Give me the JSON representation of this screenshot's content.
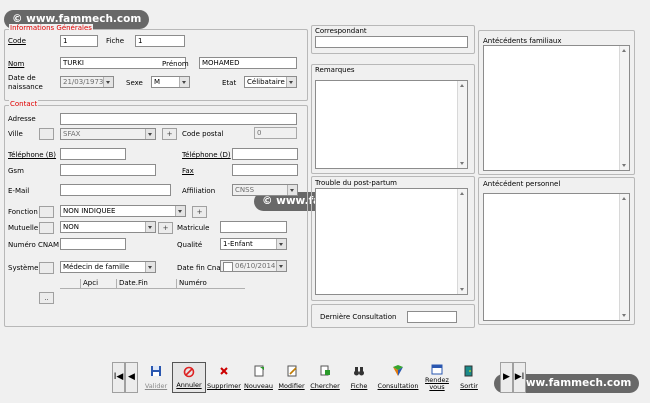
{
  "watermark": "© www.fammech.com",
  "info_generales": {
    "legend": "Informations Générales",
    "code_label": "Code",
    "code_value": "1",
    "fiche_label": "Fiche",
    "fiche_value": "1",
    "nom_label": "Nom",
    "nom_value": "TURKI",
    "prenom_label": "Prénom",
    "prenom_value": "MOHAMED",
    "date_naissance_label_1": "Date de",
    "date_naissance_label_2": "naissance",
    "date_naissance_value": "21/03/1973",
    "sexe_label": "Sexe",
    "sexe_value": "M",
    "etat_label": "Etat",
    "etat_value": "Célibataire"
  },
  "contact": {
    "legend": "Contact",
    "adresse_label": "Adresse",
    "adresse_value": "",
    "ville_label": "Ville",
    "ville_value": "SFAX",
    "code_postal_label": "Code postal",
    "code_postal_value": "0",
    "tel_b_label": "Téléphone (B)",
    "tel_b_value": "",
    "tel_d_label": "Téléphone (D)",
    "tel_d_value": "",
    "gsm_label": "Gsm",
    "gsm_value": "",
    "fax_label": "Fax",
    "fax_value": "",
    "email_label": "E-Mail",
    "email_value": "",
    "affiliation_label": "Affiliation",
    "affiliation_value": "CNSS",
    "fonction_label": "Fonction",
    "fonction_value": "NON INDIQUEE",
    "mutuelle_label": "Mutuelle",
    "mutuelle_value": "NON",
    "matricule_label": "Matricule",
    "matricule_value": "",
    "numero_cnam_label": "Numéro CNAM",
    "numero_cnam_value": "",
    "qualite_label": "Qualité",
    "qualite_value": "1-Enfant",
    "systeme_label": "Système",
    "systeme_value": "Médecin de famille",
    "date_fin_cnam_label": "Date fin Cnam",
    "date_fin_cnam_value": "06/10/2014",
    "table_headers": [
      "Apci",
      "Date.Fin",
      "Numéro"
    ],
    "small_button_dots": "..",
    "small_button_plus": "+"
  },
  "correspondant": {
    "label": "Correspondant",
    "value": ""
  },
  "remarques": {
    "label": "Remarques"
  },
  "trouble": {
    "label": "Trouble du post-partum"
  },
  "derniere_consultation": {
    "label": "Dernière Consultation",
    "value": ""
  },
  "antecedents_familiaux": {
    "label": "Antécédents familiaux"
  },
  "antecedent_personnel": {
    "label": "Antécédent personnel"
  },
  "toolbar": {
    "nav_first": "I◀",
    "nav_prev": "◀",
    "nav_next": "▶",
    "nav_last": "▶I",
    "valider": "Valider",
    "annuler": "Annuler",
    "supprimer": "Supprimer",
    "nouveau": "Nouveau",
    "modifier": "Modifier",
    "chercher": "Chercher",
    "fiche": "Fiche",
    "consultation": "Consultation",
    "rendez_vous_1": "Rendez",
    "rendez_vous_2": "vous",
    "sortir": "Sortir"
  },
  "colors": {
    "legend_red": "#e00000",
    "window_bg": "#f0f0f0"
  }
}
